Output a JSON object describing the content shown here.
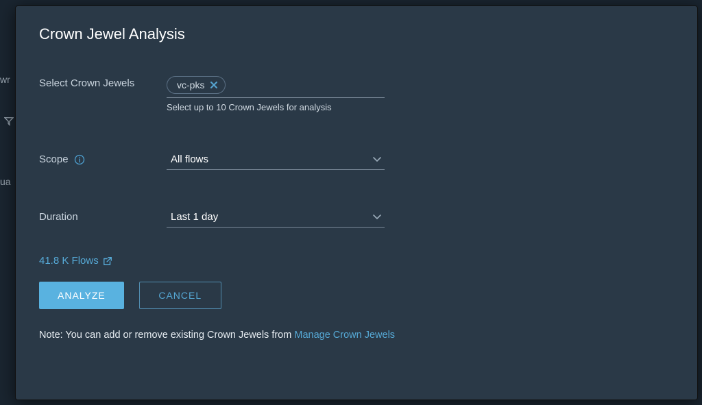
{
  "dialog": {
    "title": "Crown Jewel Analysis",
    "crownJewels": {
      "label": "Select Crown Jewels",
      "chips": [
        {
          "label": "vc-pks"
        }
      ],
      "helper": "Select up to 10 Crown Jewels for analysis"
    },
    "scope": {
      "label": "Scope",
      "value": "All flows"
    },
    "duration": {
      "label": "Duration",
      "value": "Last 1 day"
    },
    "flowsLinkText": "41.8 K Flows",
    "buttons": {
      "analyze": "ANALYZE",
      "cancel": "CANCEL"
    },
    "footer": {
      "noteStatic": "Note: You can add or remove existing Crown Jewels from ",
      "linkText": "Manage Crown Jewels"
    }
  },
  "backdrop": {
    "partial1": "wr",
    "partial2": "ua"
  }
}
